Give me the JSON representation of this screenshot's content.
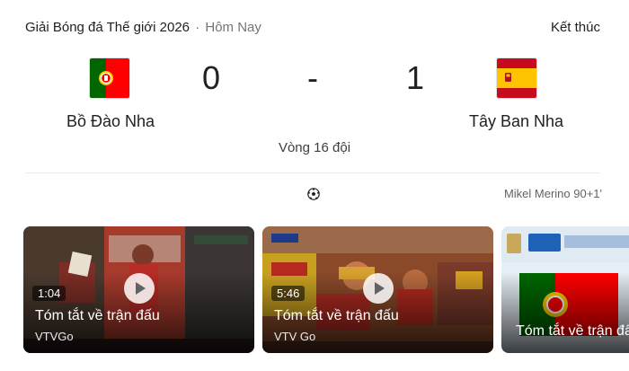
{
  "header": {
    "competition": "Giải Bóng đá Thế giới 2026",
    "separator": "·",
    "day": "Hôm Nay",
    "status": "Kết thúc"
  },
  "match": {
    "home": {
      "name": "Bồ Đào Nha",
      "score": "0",
      "flag_icon": "portugal-flag-icon"
    },
    "away": {
      "name": "Tây Ban Nha",
      "score": "1",
      "flag_icon": "spain-flag-icon"
    },
    "dash": "-",
    "round": "Vòng 16 đội",
    "goal_icon": "soccer-ball-icon",
    "scorer": "Mikel Merino 90+1'"
  },
  "videos": [
    {
      "duration": "1:04",
      "title": "Tóm tắt về trận đấu",
      "source": "VTVGo"
    },
    {
      "duration": "5:46",
      "title": "Tóm tắt về trận đấu",
      "source": "VTV Go"
    },
    {
      "title": "Tóm tắt về trận đấu"
    }
  ],
  "colors": {
    "portugal_green": "#006600",
    "portugal_red": "#ff0000",
    "spain_red": "#c60b1e",
    "spain_yellow": "#ffc400"
  }
}
